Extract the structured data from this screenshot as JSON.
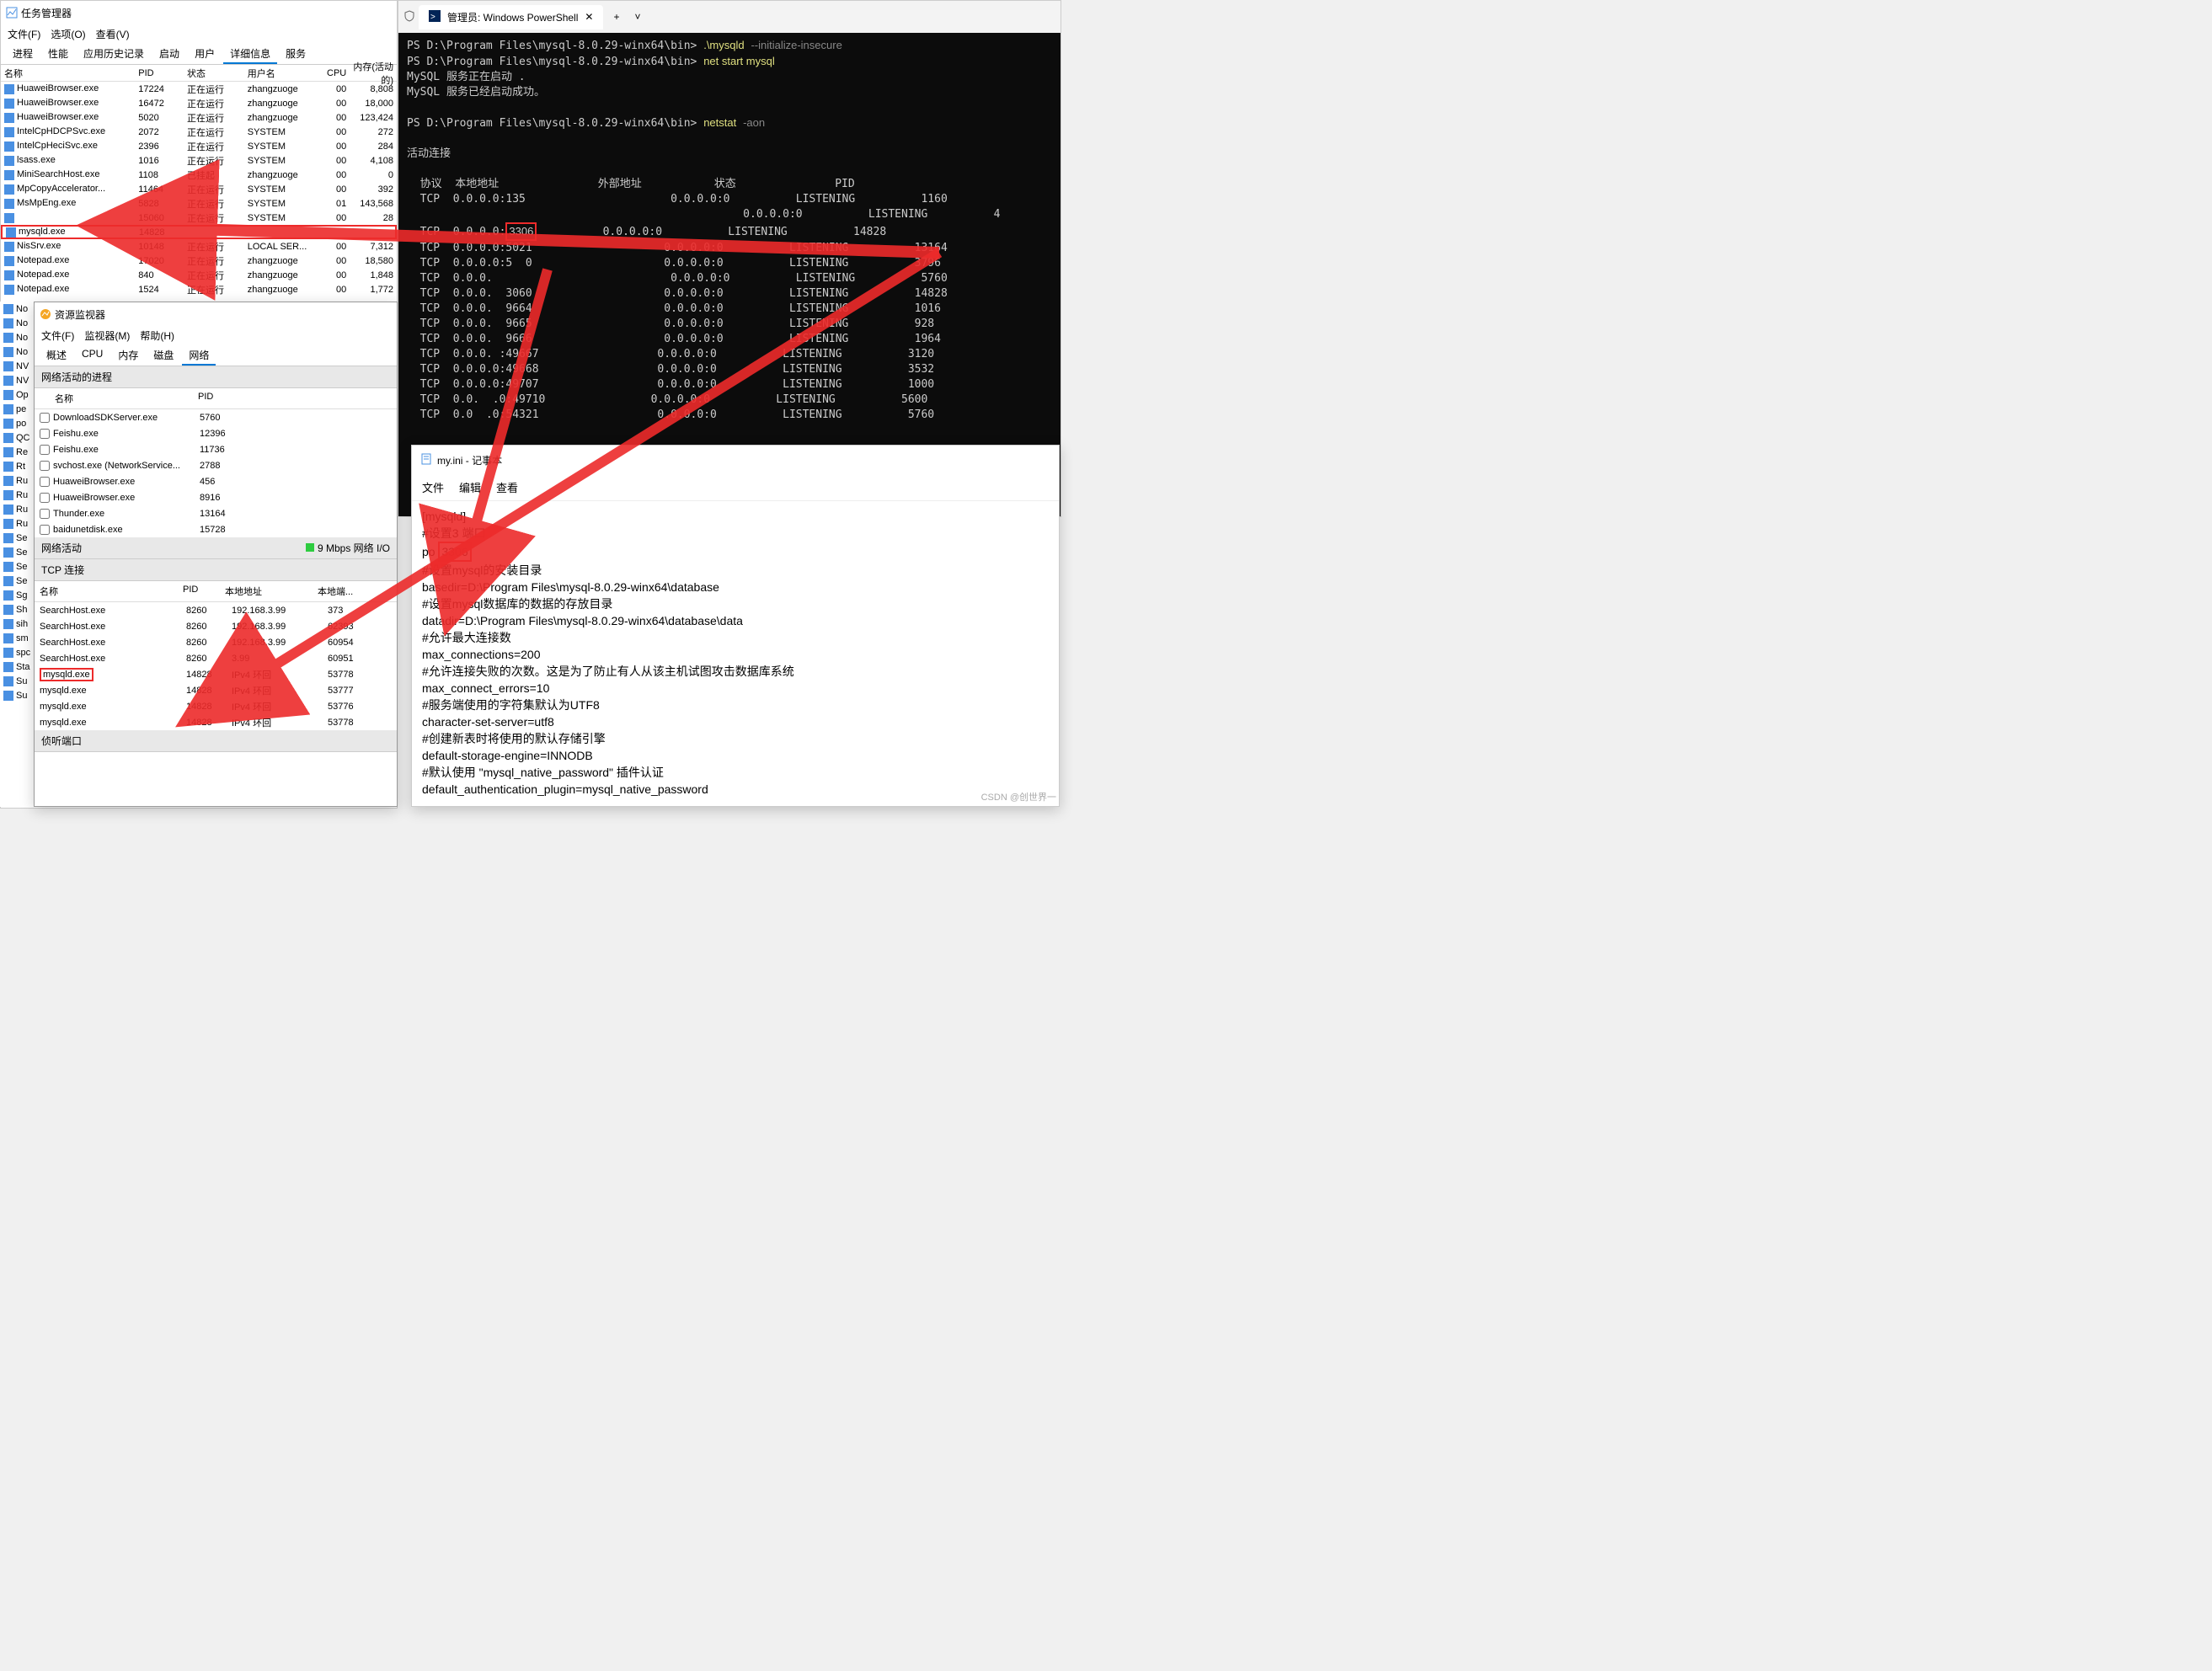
{
  "taskmgr": {
    "title": "任务管理器",
    "menu": [
      "文件(F)",
      "选项(O)",
      "查看(V)"
    ],
    "tabs": [
      "进程",
      "性能",
      "应用历史记录",
      "启动",
      "用户",
      "详细信息",
      "服务"
    ],
    "active_tab": 5,
    "columns": [
      "名称",
      "PID",
      "状态",
      "用户名",
      "CPU",
      "内存(活动的)"
    ],
    "rows": [
      {
        "name": "HuaweiBrowser.exe",
        "pid": "17224",
        "stat": "正在运行",
        "user": "zhangzuoge",
        "cpu": "00",
        "mem": "8,808"
      },
      {
        "name": "HuaweiBrowser.exe",
        "pid": "16472",
        "stat": "正在运行",
        "user": "zhangzuoge",
        "cpu": "00",
        "mem": "18,000"
      },
      {
        "name": "HuaweiBrowser.exe",
        "pid": "5020",
        "stat": "正在运行",
        "user": "zhangzuoge",
        "cpu": "00",
        "mem": "123,424"
      },
      {
        "name": "IntelCpHDCPSvc.exe",
        "pid": "2072",
        "stat": "正在运行",
        "user": "SYSTEM",
        "cpu": "00",
        "mem": "272"
      },
      {
        "name": "IntelCpHeciSvc.exe",
        "pid": "2396",
        "stat": "正在运行",
        "user": "SYSTEM",
        "cpu": "00",
        "mem": "284"
      },
      {
        "name": "lsass.exe",
        "pid": "1016",
        "stat": "正在运行",
        "user": "SYSTEM",
        "cpu": "00",
        "mem": "4,108"
      },
      {
        "name": "MiniSearchHost.exe",
        "pid": "1108",
        "stat": "已挂起",
        "user": "zhangzuoge",
        "cpu": "00",
        "mem": "0"
      },
      {
        "name": "MpCopyAccelerator...",
        "pid": "11464",
        "stat": "正在运行",
        "user": "SYSTEM",
        "cpu": "00",
        "mem": "392"
      },
      {
        "name": "MsMpEng.exe",
        "pid": "5828",
        "stat": "正在运行",
        "user": "SYSTEM",
        "cpu": "01",
        "mem": "143,568"
      },
      {
        "name": "",
        "pid": "15060",
        "stat": "正在运行",
        "user": "SYSTEM",
        "cpu": "00",
        "mem": "28"
      },
      {
        "name": "mysqld.exe",
        "pid": "14828",
        "stat": "",
        "user": "",
        "cpu": "",
        "mem": "",
        "sel": true
      },
      {
        "name": "NisSrv.exe",
        "pid": "10148",
        "stat": "正在运行",
        "user": "LOCAL SER...",
        "cpu": "00",
        "mem": "7,312"
      },
      {
        "name": "Notepad.exe",
        "pid": "17020",
        "stat": "正在运行",
        "user": "zhangzuoge",
        "cpu": "00",
        "mem": "18,580"
      },
      {
        "name": "Notepad.exe",
        "pid": "840",
        "stat": "正在运行",
        "user": "zhangzuoge",
        "cpu": "00",
        "mem": "1,848"
      },
      {
        "name": "Notepad.exe",
        "pid": "1524",
        "stat": "正在运行",
        "user": "zhangzuoge",
        "cpu": "00",
        "mem": "1,772"
      }
    ],
    "bg_fragments": [
      "No",
      "No",
      "No",
      "No",
      "NV",
      "NV",
      "Op",
      "pe",
      "po",
      "QC",
      "Re",
      "Rt",
      "Ru",
      "Ru",
      "Ru",
      "Ru",
      "Se",
      "Se",
      "Se",
      "Se",
      "Sg",
      "Sh",
      "sih",
      "sm",
      "spc",
      "Sta",
      "Su",
      "Su"
    ]
  },
  "resmon": {
    "title": "资源监视器",
    "menu": [
      "文件(F)",
      "监视器(M)",
      "帮助(H)"
    ],
    "tabs": [
      "概述",
      "CPU",
      "内存",
      "磁盘",
      "网络"
    ],
    "active_tab": 4,
    "section1": "网络活动的进程",
    "proc_cols": [
      "名称",
      "PID"
    ],
    "procs": [
      {
        "name": "DownloadSDKServer.exe",
        "pid": "5760"
      },
      {
        "name": "Feishu.exe",
        "pid": "12396"
      },
      {
        "name": "Feishu.exe",
        "pid": "11736"
      },
      {
        "name": "svchost.exe (NetworkService...",
        "pid": "2788"
      },
      {
        "name": "HuaweiBrowser.exe",
        "pid": "456"
      },
      {
        "name": "HuaweiBrowser.exe",
        "pid": "8916"
      },
      {
        "name": "Thunder.exe",
        "pid": "13164"
      },
      {
        "name": "baidunetdisk.exe",
        "pid": "15728"
      }
    ],
    "section2": "网络活动",
    "net_label": "9 Mbps 网络 I/O",
    "section3": "TCP 连接",
    "tcp_cols": [
      "名称",
      "PID",
      "本地地址",
      "本地端..."
    ],
    "tcp_rows": [
      {
        "name": "SearchHost.exe",
        "pid": "8260",
        "la": "192.168.3.99",
        "lp": "373"
      },
      {
        "name": "SearchHost.exe",
        "pid": "8260",
        "la": "192.168.3.99",
        "lp": "62393"
      },
      {
        "name": "SearchHost.exe",
        "pid": "8260",
        "la": "192.168.3.99",
        "lp": "60954"
      },
      {
        "name": "SearchHost.exe",
        "pid": "8260",
        "la": "3.99",
        "lp": "60951"
      },
      {
        "name": "mysqld.exe",
        "pid": "14828",
        "la": "IPv4 环回",
        "lp": "53778",
        "sel": true
      },
      {
        "name": "mysqld.exe",
        "pid": "14828",
        "la": "IPv4 环回",
        "lp": "53777"
      },
      {
        "name": "mysqld.exe",
        "pid": "14828",
        "la": "IPv4 环回",
        "lp": "53776"
      },
      {
        "name": "mysqld.exe",
        "pid": "14828",
        "la": "IPv4 环回",
        "lp": "53778"
      }
    ],
    "section4": "侦听端口"
  },
  "ps": {
    "tab_title": "管理员: Windows PowerShell",
    "prompt": "PS D:\\Program Files\\mysql-8.0.29-winx64\\bin>",
    "cmd1": ".\\mysqld",
    "arg1": "--initialize-insecure",
    "cmd2": "net start mysql",
    "out2a": "MySQL 服务正在启动 .",
    "out2b": "MySQL 服务已经启动成功。",
    "cmd3": "netstat",
    "arg3": "-aon",
    "conn_header": "活动连接",
    "cols": "  协议  本地地址               外部地址           状态               PID",
    "rows": [
      {
        "p": "TCP",
        "la": "0.0.0.0:135",
        "fa": "0.0.0.0:0",
        "st": "LISTENING",
        "pid": "1160"
      },
      {
        "p": "",
        "la": "",
        "fa": "0.0.0.0:0",
        "st": "LISTENING",
        "pid": "4"
      },
      {
        "p": "TCP",
        "la": "0.0.0.0:",
        "port": "3306",
        "fa": "0.0.0.0:0",
        "st": "LISTENING",
        "pid": "14828",
        "box": true
      },
      {
        "p": "TCP",
        "la": "0.0.0.0:5021",
        "fa": "0.0.0.0:0",
        "st": "LISTENING",
        "pid": "13164"
      },
      {
        "p": "TCP",
        "la": "0.0.0.0:5  0",
        "fa": "0.0.0.0:0",
        "st": "LISTENING",
        "pid": "3796"
      },
      {
        "p": "TCP",
        "la": "0.0.0.     ",
        "fa": "0.0.0.0:0",
        "st": "LISTENING",
        "pid": "5760"
      },
      {
        "p": "TCP",
        "la": "0.0.0.  3060",
        "fa": "0.0.0.0:0",
        "st": "LISTENING",
        "pid": "14828"
      },
      {
        "p": "TCP",
        "la": "0.0.0.  9664",
        "fa": "0.0.0.0:0",
        "st": "LISTENING",
        "pid": "1016"
      },
      {
        "p": "TCP",
        "la": "0.0.0.  9665",
        "fa": "0.0.0.0:0",
        "st": "LISTENING",
        "pid": "928"
      },
      {
        "p": "TCP",
        "la": "0.0.0.  9666",
        "fa": "0.0.0.0:0",
        "st": "LISTENING",
        "pid": "1964"
      },
      {
        "p": "TCP",
        "la": "0.0.0. :49667",
        "fa": "0.0.0.0:0",
        "st": "LISTENING",
        "pid": "3120"
      },
      {
        "p": "TCP",
        "la": "0.0.0.0:49668",
        "fa": "0.0.0.0:0",
        "st": "LISTENING",
        "pid": "3532"
      },
      {
        "p": "TCP",
        "la": "0.0.0.0:49707",
        "fa": "0.0.0.0:0",
        "st": "LISTENING",
        "pid": "1000"
      },
      {
        "p": "TCP",
        "la": "0.0.  .0:49710",
        "fa": "0.0.0.0:0",
        "st": "LISTENING",
        "pid": "5600"
      },
      {
        "p": "TCP",
        "la": "0.0  .0:54321",
        "fa": "0.0.0.0:0",
        "st": "LISTENING",
        "pid": "5760"
      }
    ]
  },
  "notepad": {
    "title": "my.ini - 记事本",
    "menu": [
      "文件",
      "编辑",
      "查看"
    ],
    "lines": [
      "[mysqld]",
      "#设置3    端口",
      [
        "po   ",
        "3306"
      ],
      "#设置mysql的安装目录",
      "basedir=D:\\Program Files\\mysql-8.0.29-winx64\\database",
      "#设置mysql数据库的数据的存放目录",
      "datadir=D:\\Program Files\\mysql-8.0.29-winx64\\database\\data",
      "#允许最大连接数",
      "max_connections=200",
      "#允许连接失败的次数。这是为了防止有人从该主机试图攻击数据库系统",
      "max_connect_errors=10",
      "#服务端使用的字符集默认为UTF8",
      "character-set-server=utf8",
      "#创建新表时将使用的默认存储引擎",
      "default-storage-engine=INNODB",
      "#默认使用 \"mysql_native_password\" 插件认证",
      "default_authentication_plugin=mysql_native_password"
    ]
  },
  "watermark": "CSDN @创世界一"
}
